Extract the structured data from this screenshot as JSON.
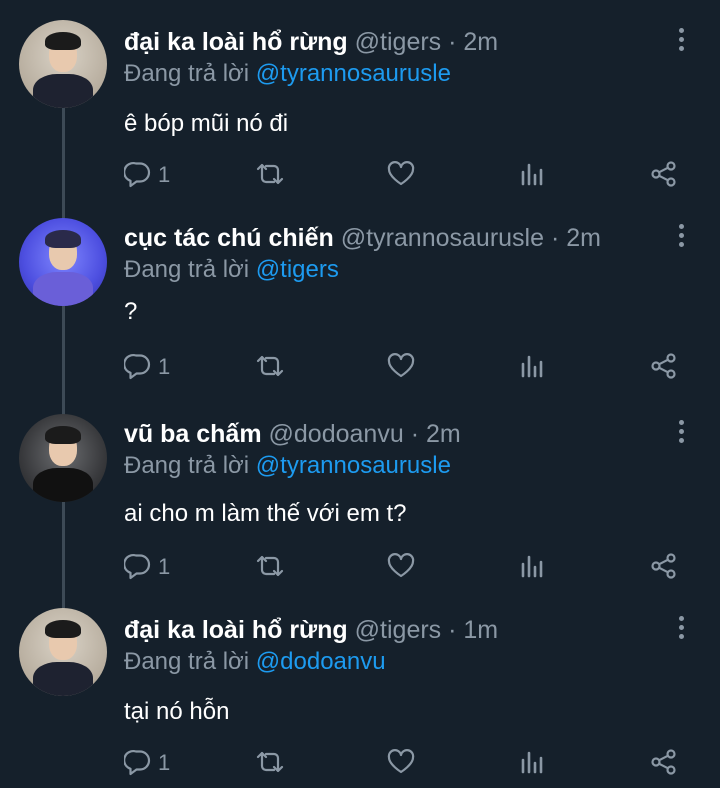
{
  "tweets": [
    {
      "name": "đại ka loài hổ rừng",
      "handle": "@tigers",
      "time": "· 2m",
      "reply_prefix": "Đang trả lời",
      "reply_to": "@tyrannosaurusle",
      "text": "ê bóp mũi nó đi",
      "reply_count": "1",
      "avatar": "avatar-light"
    },
    {
      "name": "cục tác chú chiến",
      "handle": "@tyrannosaurusle",
      "time": "· 2m",
      "reply_prefix": "Đang trả lời",
      "reply_to": "@tigers",
      "text": "?",
      "reply_count": "1",
      "avatar": "avatar-blue"
    },
    {
      "name": "vũ ba chấm",
      "handle": "@dodoanvu",
      "time": "· 2m",
      "reply_prefix": "Đang trả lời",
      "reply_to": "@tyrannosaurusle",
      "text": "ai cho m làm thế với em t?",
      "reply_count": "1",
      "avatar": "avatar-dark"
    },
    {
      "name": "đại ka loài hổ rừng",
      "handle": "@tigers",
      "time": "· 1m",
      "reply_prefix": "Đang trả lời",
      "reply_to": "@dodoanvu",
      "text": "tại nó hỗn",
      "reply_count": "1",
      "avatar": "avatar-light"
    }
  ],
  "icons": {
    "reply": "reply-icon",
    "retweet": "retweet-icon",
    "like": "heart-icon",
    "stats": "stats-icon",
    "share": "share-icon",
    "more": "more-icon"
  },
  "colors": {
    "background": "#15202b",
    "link": "#1d9bf0",
    "muted": "#8b98a5",
    "thread": "#3d4a56"
  }
}
